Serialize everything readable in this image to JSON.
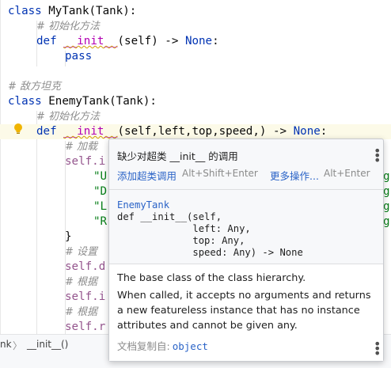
{
  "editor": {
    "lines": [
      {
        "top": "class_def",
        "class_kw": "class",
        "class_name": " MyTank(Tank):"
      },
      {
        "comment": "# 初始化方法"
      },
      {
        "def_kw": "def",
        "dunder": "__init__",
        "rest": "(self) -> ",
        "none_kw": "None",
        "colon": ":"
      },
      {
        "pass_kw": "pass"
      },
      {
        "comment": "# 敌方坦克"
      },
      {
        "class_kw": "class",
        "class_name": " EnemyTank(Tank):"
      },
      {
        "comment": "# 初始化方法"
      },
      {
        "def_kw": "def",
        "dunder": "__init__",
        "rest": "(self,left,top,speed,) -> ",
        "none_kw": "None",
        "colon": ":"
      },
      {
        "comment_partial": "# 加载",
        "self_partial": "self.i"
      },
      {
        "str_u": "\"U",
        "str_d": "\"D",
        "str_l": "\"L",
        "str_r": "\"R"
      },
      {
        "brace": "}",
        "comment_set": "# 设置",
        "self_d": "self.d",
        "comment_gen": "# 根据",
        "self_i": "self.i",
        "comment_gen2": "# 根据",
        "self_r": "self.r"
      },
      {
        "tail_g": "g"
      }
    ]
  },
  "breadcrumbs": {
    "left": "nk",
    "sep": "〉",
    "right": "__init__()"
  },
  "popup": {
    "title": "缺少对超类 __init__ 的调用",
    "action_primary": "添加超类调用",
    "shortcut_primary": "Alt+Shift+Enter",
    "action_more": "更多操作...",
    "shortcut_more": "Alt+Enter",
    "signature": {
      "class_name": "EnemyTank",
      "line1": "def __init__(self,",
      "line2": "             left: Any,",
      "line3": "             top: Any,",
      "line4": "             speed: Any) -> None"
    },
    "doc_p1": "The base class of the class hierarchy.",
    "doc_p2": "When called, it accepts no arguments and returns a new featureless instance that has no instance attributes and cannot be given any.",
    "doc_from_label": "文档复制自:",
    "doc_from_link": "object"
  },
  "colors": {
    "keyword": "#0033b3",
    "dunder": "#b200b2",
    "comment": "#8c8c8c",
    "link": "#2a63c7",
    "string": "#067d17"
  }
}
